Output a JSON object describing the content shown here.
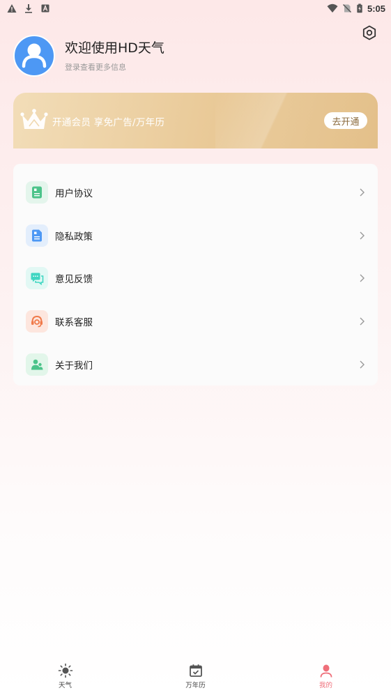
{
  "status_bar": {
    "time": "5:05",
    "left_icons": [
      "warning-icon",
      "download-icon",
      "a-icon"
    ],
    "right_icons": [
      "wifi-icon",
      "no-sim-icon",
      "battery-icon"
    ]
  },
  "profile": {
    "welcome": "欢迎使用HD天气",
    "login_hint": "登录查看更多信息"
  },
  "vip": {
    "text": "开通会员 享免广告/万年历",
    "button": "去开通"
  },
  "menu": {
    "items": [
      {
        "label": "用户协议",
        "icon": "document-icon",
        "color": "#4cc38a",
        "bg": "#e4f5ec"
      },
      {
        "label": "隐私政策",
        "icon": "privacy-document-icon",
        "color": "#4d98f4",
        "bg": "#e3eefc"
      },
      {
        "label": "意见反馈",
        "icon": "feedback-chat-icon",
        "color": "#3fd6c2",
        "bg": "#e2f8f4"
      },
      {
        "label": "联系客服",
        "icon": "headset-icon",
        "color": "#f07a4a",
        "bg": "#fde6de"
      },
      {
        "label": "关于我们",
        "icon": "people-icon",
        "color": "#4cc38a",
        "bg": "#e2f6ea"
      }
    ]
  },
  "bottom_nav": {
    "tabs": [
      {
        "label": "天气",
        "icon": "sun-icon",
        "active": false
      },
      {
        "label": "万年历",
        "icon": "calendar-icon",
        "active": false
      },
      {
        "label": "我的",
        "icon": "user-icon",
        "active": true
      }
    ]
  },
  "colors": {
    "accent": "#ef6f7a",
    "avatar": "#4d98f4",
    "vip_gold": "#e9c997"
  }
}
